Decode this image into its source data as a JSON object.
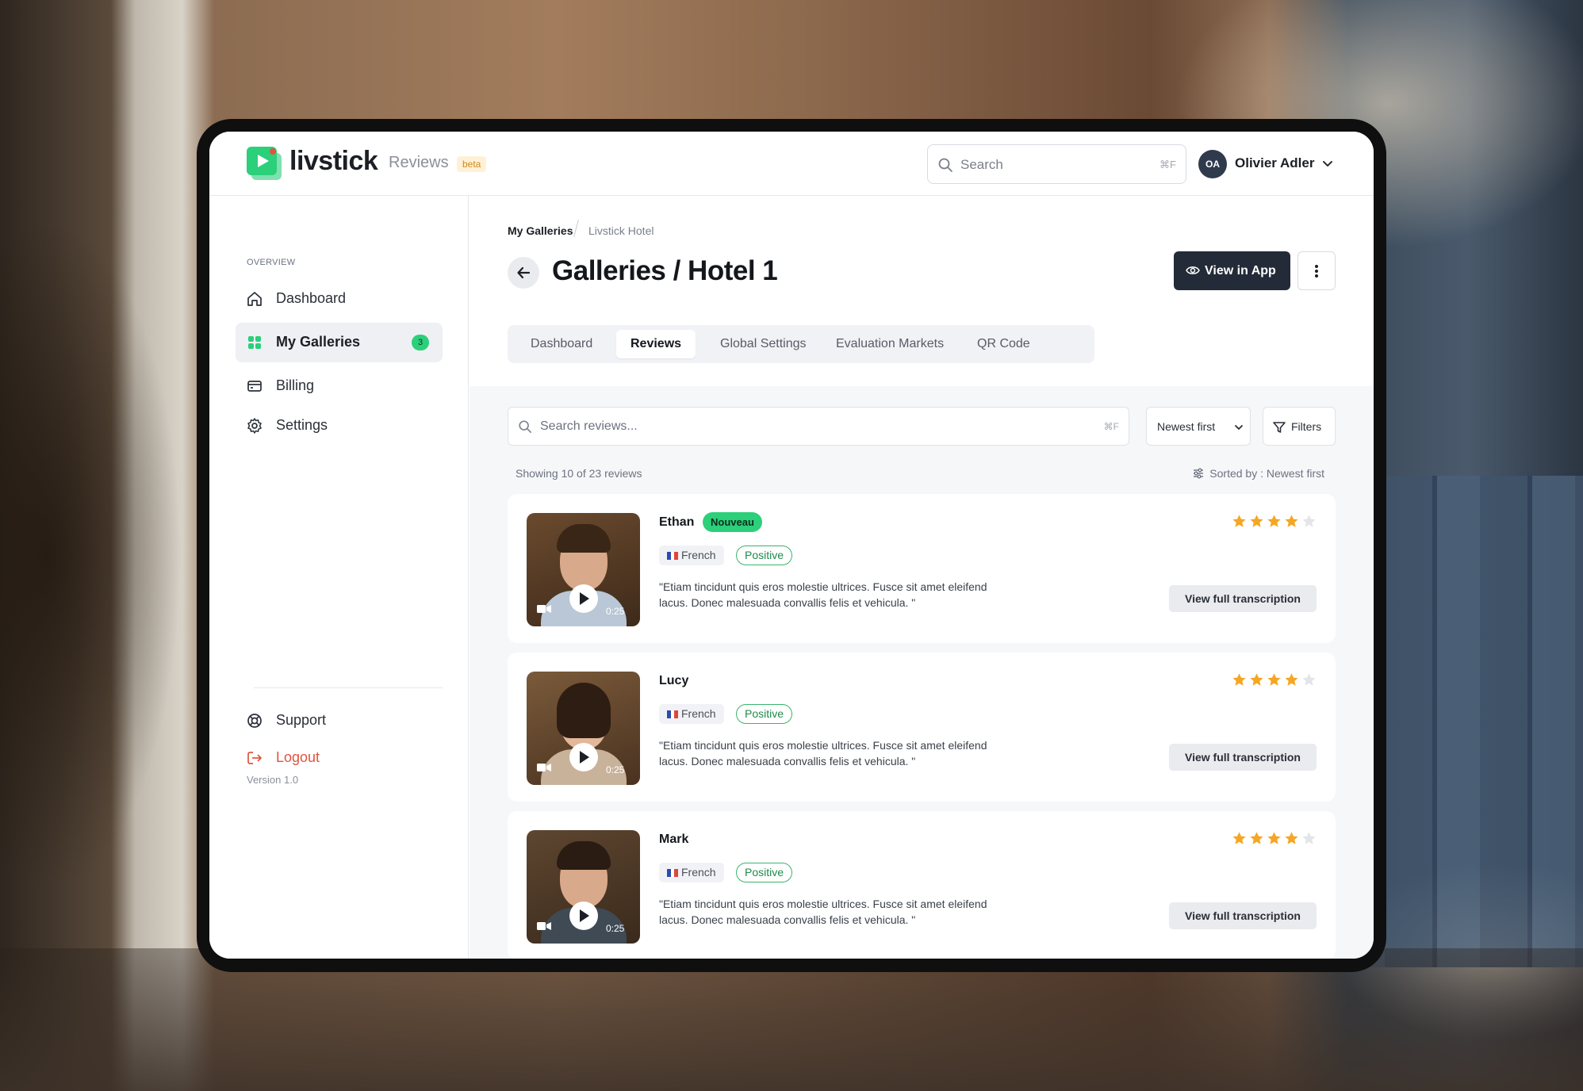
{
  "app": {
    "logo_text": "livstick",
    "product": "Reviews",
    "beta_badge": "beta",
    "accent_color": "#2ccf7a"
  },
  "header": {
    "search_placeholder": "Search",
    "search_shortcut": "⌘F",
    "user_initials": "OA",
    "user_name": "Olivier Adler"
  },
  "sidebar": {
    "section_label": "OVERVIEW",
    "items": [
      {
        "label": "Dashboard",
        "icon": "home-icon"
      },
      {
        "label": "My Galleries",
        "icon": "grid-icon",
        "badge": "3",
        "active": true
      },
      {
        "label": "Billing",
        "icon": "billing-icon"
      },
      {
        "label": "Settings",
        "icon": "gear-icon"
      }
    ],
    "bottom_items": [
      {
        "label": "Support",
        "icon": "lifebuoy-icon"
      },
      {
        "label": "Logout",
        "icon": "logout-icon"
      }
    ],
    "version": "Version 1.0"
  },
  "main": {
    "breadcrumb": [
      "My Galleries",
      "Livstick Hotel"
    ],
    "title": "Galleries / Hotel 1",
    "view_in_app_label": "View in App",
    "tabs": [
      "Dashboard",
      "Reviews",
      "Global Settings",
      "Evaluation Markets",
      "QR Code"
    ],
    "active_tab": "Reviews",
    "review_search_placeholder": "Search reviews...",
    "review_search_shortcut": "⌘F",
    "sort_label": "Newest first",
    "filters_label": "Filters",
    "showing_text": "Showing 10 of 23 reviews",
    "sorted_by_text": "Sorted by : Newest first"
  },
  "reviews": [
    {
      "name": "Ethan",
      "badge": "Nouveau",
      "language": "French",
      "sentiment": "Positive",
      "quote": "\"Etiam tincidunt quis eros molestie ultrices. Fusce sit amet eleifend lacus. Donec malesuada convallis felis et vehicula. \"",
      "duration": "0:25",
      "rating": 4,
      "max_rating": 5,
      "action_label": "View full transcription"
    },
    {
      "name": "Lucy",
      "badge": "",
      "language": "French",
      "sentiment": "Positive",
      "quote": "\"Etiam tincidunt quis eros molestie ultrices. Fusce sit amet eleifend lacus. Donec malesuada convallis felis et vehicula. \"",
      "duration": "0:25",
      "rating": 4,
      "max_rating": 5,
      "action_label": "View full transcription"
    },
    {
      "name": "Mark",
      "badge": "",
      "language": "French",
      "sentiment": "Positive",
      "quote": "\"Etiam tincidunt quis eros molestie ultrices. Fusce sit amet eleifend lacus. Donec malesuada convallis felis et vehicula. \"",
      "duration": "0:25",
      "rating": 4,
      "max_rating": 5,
      "action_label": "View full transcription"
    }
  ]
}
